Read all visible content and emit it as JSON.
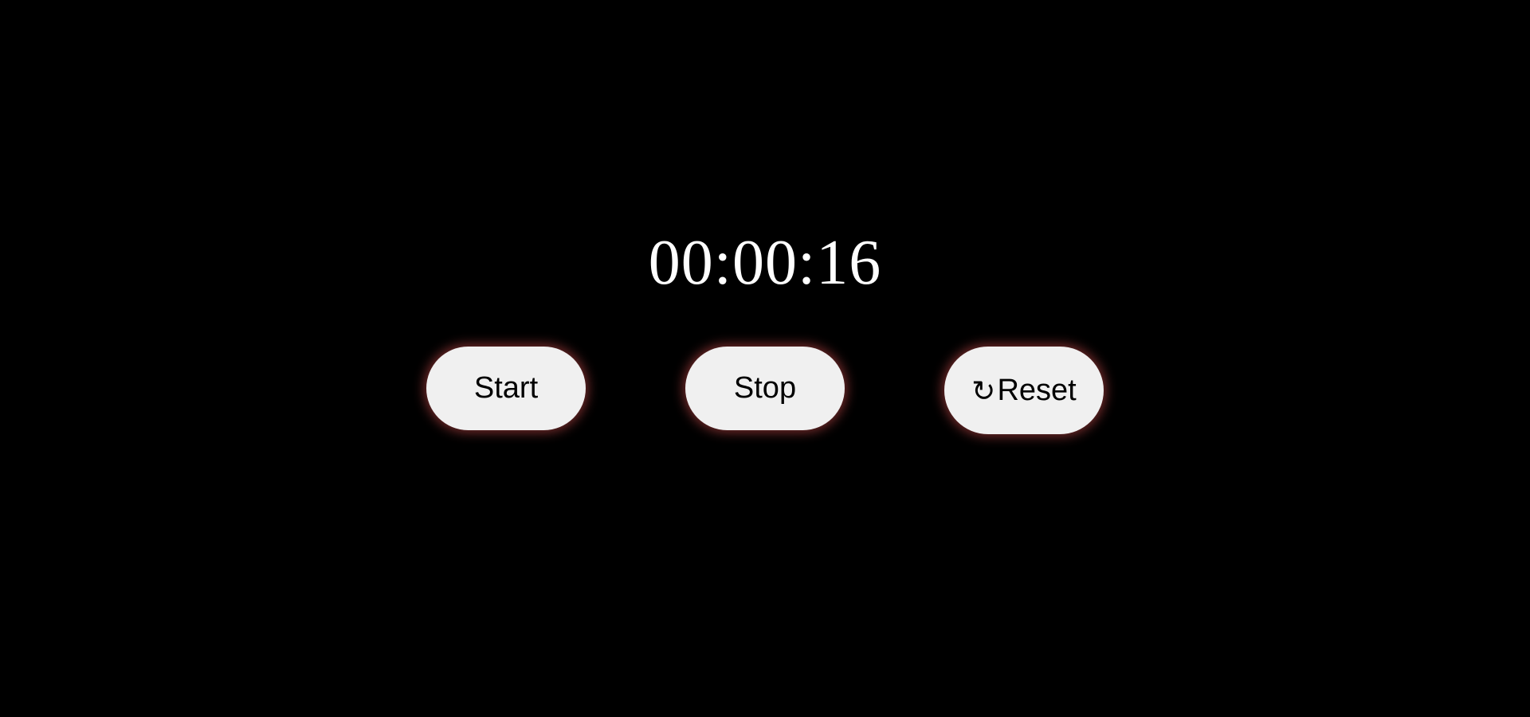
{
  "timer": {
    "display": "00:00:16"
  },
  "controls": {
    "start_label": "Start",
    "stop_label": "Stop",
    "reset_label": "Reset",
    "reset_icon": "↻"
  },
  "colors": {
    "background": "#000000",
    "timer_text": "#ffffff",
    "button_fill": "#f0f0f0",
    "button_glow": "#d75050"
  },
  "icons": {
    "reset": "reset-icon"
  }
}
